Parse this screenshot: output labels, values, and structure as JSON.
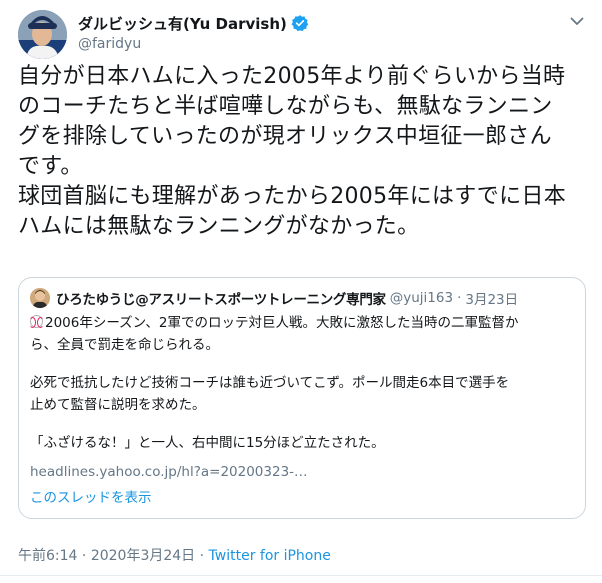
{
  "author": {
    "name": "ダルビッシュ有(Yu Darvish)",
    "handle": "@faridyu",
    "verified": true,
    "avatar_icon": "avatar-photo-icon",
    "verified_color": "#1da1f2"
  },
  "menu_icon": "chevron-down-icon",
  "tweet": {
    "paragraph1": "自分が日本ハムに入った2005年より前ぐらいから当時\nのコーチたちと半ば喧嘩しながらも、無駄なランニン\nグを排除していったのが現オリックス中垣征一郎さん\nです。",
    "paragraph2": "球団首脳にも理解があったから2005年にはすでに日本\nハムには無駄なランニングがなかった。"
  },
  "quote": {
    "name": "ひろたゆうじ@アスリートスポーツトレーニング専門家",
    "handle": "@yuji163",
    "separator": "·",
    "date": "3月23日",
    "lines": [
      "2006年シーズン、2軍でのロッテ対巨人戦。大敗に激怒した当時の二軍監督か",
      "ら、全員で罰走を命じられる。",
      "必死で抵抗したけど技術コーチは誰も近づいてこず。ポール間走6本目で選手を",
      "止めて監督に説明を求めた。",
      "「ふざけるな！」と一人、右中間に15分ほど立たされた。"
    ],
    "link": "headlines.yahoo.co.jp/hl?a=20200323-…",
    "show_thread": "このスレッドを表示",
    "emoji_icon": "baseball-icon"
  },
  "meta": {
    "time": "午前6:14",
    "separator": "·",
    "date": "2020年3月24日",
    "source": "Twitter for iPhone"
  },
  "colors": {
    "text": "#14171a",
    "secondary": "#657786",
    "link": "#1b95e0",
    "border": "#ccd6dd"
  }
}
